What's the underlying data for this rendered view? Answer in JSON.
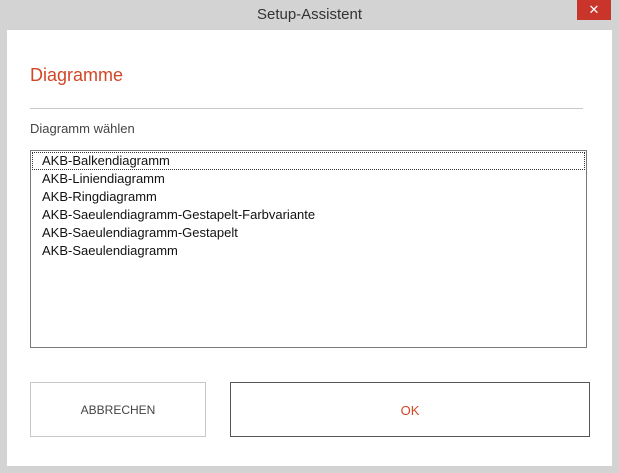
{
  "window": {
    "title": "Setup-Assistent",
    "close_label": "✕"
  },
  "dialog": {
    "heading": "Diagramme",
    "list_label": "Diagramm wählen",
    "items": [
      "AKB-Balkendiagramm",
      "AKB-Liniendiagramm",
      "AKB-Ringdiagramm",
      "AKB-Saeulendiagramm-Gestapelt-Farbvariante",
      "AKB-Saeulendiagramm-Gestapelt",
      "AKB-Saeulendiagramm"
    ],
    "cancel_label": "ABBRECHEN",
    "ok_label": "OK"
  },
  "colors": {
    "accent": "#d24726",
    "close": "#c9352b"
  },
  "icons": {
    "close": "close-icon"
  }
}
